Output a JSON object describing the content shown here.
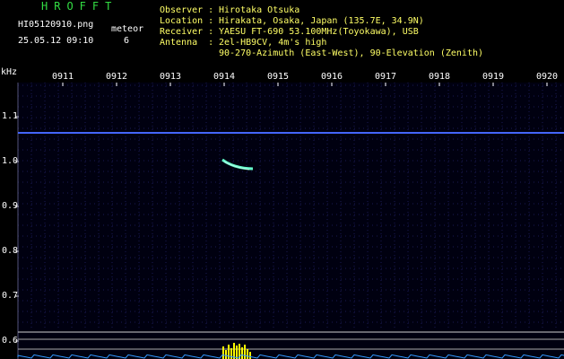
{
  "header": {
    "app_title": "HROFFT",
    "filename": "HI05120910.png",
    "meteor_label": "meteor",
    "meteor_count": "6",
    "datetime": "25.05.12 09:10",
    "info_labels": [
      "Observer :",
      "Location :",
      "Receiver :",
      "Antenna  :"
    ],
    "info_values": [
      "Hirotaka Otsuka",
      "Hirakata, Osaka, Japan (135.7E, 34.9N)",
      "YAESU FT-690 53.100MHz(Toyokawa), USB",
      "2el-HB9CV, 4m's high"
    ],
    "antenna_line2": "90-270-Azimuth (East-West), 90-Elevation (Zenith)"
  },
  "spectrogram": {
    "y_unit": "kHz",
    "y_ticks": [
      "1.1",
      "1.0",
      "0.9",
      "0.8",
      "0.7",
      "0.6"
    ],
    "time_ticks": [
      "0911",
      "0912",
      "0913",
      "0914",
      "0915",
      "0916",
      "0917",
      "0918",
      "0919",
      "0920"
    ],
    "colors": {
      "background": "#000010",
      "carrier": "#4466ff",
      "meteor_echo": "#66ffcc",
      "level_bars": "#ffff00",
      "baseline": "#3399ff",
      "grid": "#1a1a55",
      "axis_text": "#ffffff"
    }
  }
}
